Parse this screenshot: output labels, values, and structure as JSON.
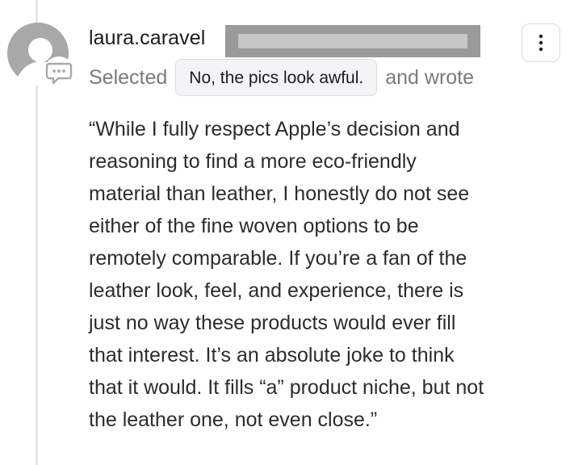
{
  "comment": {
    "username": "laura.caravel",
    "action_prefix": "Selected",
    "selected_choice": "No, the pics look awful.",
    "action_suffix": "and wrote",
    "body_lines": [
      "“While I fully respect Apple’s decision and",
      "reasoning to find a more eco-friendly",
      "material than leather, I honestly do not see",
      "either of the fine woven options to be",
      "remotely comparable. If you’re a fan of the",
      "leather look, feel, and experience, there is",
      "just no way these products would ever fill",
      "that interest. It’s an absolute joke to think",
      "that it would. It fills “a” product niche, but not",
      "the leather one, not even close.”"
    ]
  },
  "icons": {
    "avatar": "default-user-avatar",
    "badge": "comment-bubble-icon",
    "menu": "more-vertical-icon"
  },
  "colors": {
    "avatar_gray": "#a8a8a8",
    "chip_background": "#f4f4f6",
    "secondary_text": "#7a7a7e",
    "thread_line": "#e7e7ea"
  }
}
